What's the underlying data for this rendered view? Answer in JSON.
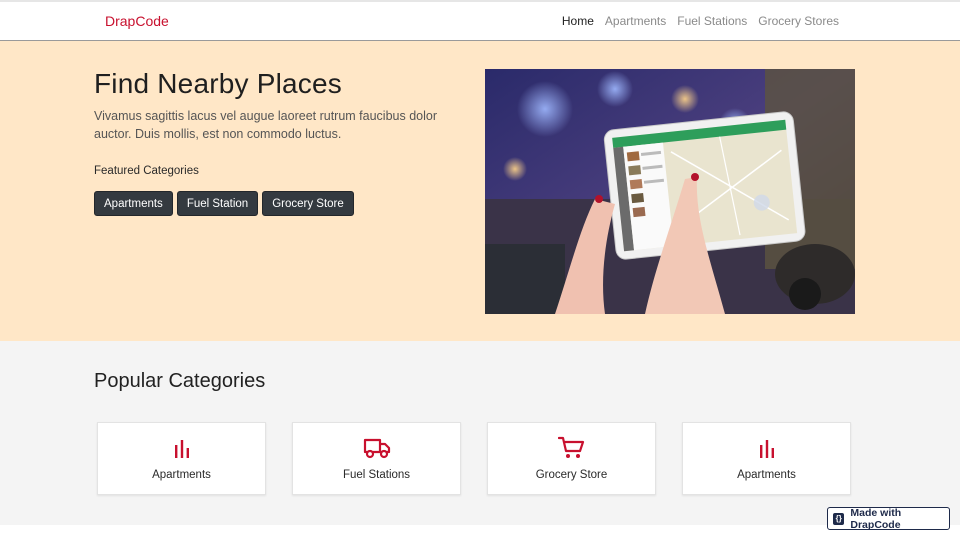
{
  "navbar": {
    "brand": "DrapCode",
    "links": [
      "Home",
      "Apartments",
      "Fuel Stations",
      "Grocery Stores"
    ]
  },
  "hero": {
    "title": "Find Nearby Places",
    "lead": "Vivamus sagittis lacus vel augue laoreet rutrum faucibus dolor auctor. Duis mollis, est non commodo luctus.",
    "featured_label": "Featured Categories",
    "chips": [
      "Apartments",
      "Fuel Station",
      "Grocery Store"
    ],
    "image_icon": "tablet-map-photo"
  },
  "popular": {
    "title": "Popular Categories",
    "cards": [
      {
        "label": "Apartments",
        "icon": "bar-chart-icon"
      },
      {
        "label": "Fuel Stations",
        "icon": "truck-icon"
      },
      {
        "label": "Grocery Store",
        "icon": "cart-icon"
      },
      {
        "label": "Apartments",
        "icon": "bar-chart-icon"
      }
    ]
  },
  "badge": {
    "text": "Made with DrapCode",
    "logo_glyph": "{}"
  },
  "colors": {
    "brand": "#c8102e",
    "hero_bg": "#ffe7c7",
    "section_bg": "#f4f4f4",
    "chip_bg": "#343a40",
    "icon": "#c8102e"
  }
}
